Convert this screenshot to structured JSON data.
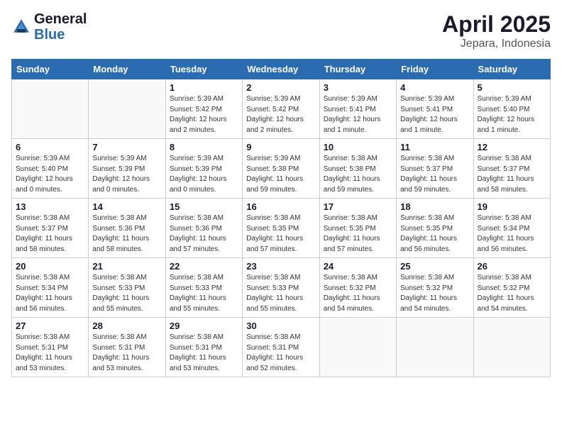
{
  "logo": {
    "line1": "General",
    "line2": "Blue"
  },
  "title": "April 2025",
  "subtitle": "Jepara, Indonesia",
  "weekdays": [
    "Sunday",
    "Monday",
    "Tuesday",
    "Wednesday",
    "Thursday",
    "Friday",
    "Saturday"
  ],
  "weeks": [
    [
      {
        "day": "",
        "info": ""
      },
      {
        "day": "",
        "info": ""
      },
      {
        "day": "1",
        "info": "Sunrise: 5:39 AM\nSunset: 5:42 PM\nDaylight: 12 hours\nand 2 minutes."
      },
      {
        "day": "2",
        "info": "Sunrise: 5:39 AM\nSunset: 5:42 PM\nDaylight: 12 hours\nand 2 minutes."
      },
      {
        "day": "3",
        "info": "Sunrise: 5:39 AM\nSunset: 5:41 PM\nDaylight: 12 hours\nand 1 minute."
      },
      {
        "day": "4",
        "info": "Sunrise: 5:39 AM\nSunset: 5:41 PM\nDaylight: 12 hours\nand 1 minute."
      },
      {
        "day": "5",
        "info": "Sunrise: 5:39 AM\nSunset: 5:40 PM\nDaylight: 12 hours\nand 1 minute."
      }
    ],
    [
      {
        "day": "6",
        "info": "Sunrise: 5:39 AM\nSunset: 5:40 PM\nDaylight: 12 hours\nand 0 minutes."
      },
      {
        "day": "7",
        "info": "Sunrise: 5:39 AM\nSunset: 5:39 PM\nDaylight: 12 hours\nand 0 minutes."
      },
      {
        "day": "8",
        "info": "Sunrise: 5:39 AM\nSunset: 5:39 PM\nDaylight: 12 hours\nand 0 minutes."
      },
      {
        "day": "9",
        "info": "Sunrise: 5:39 AM\nSunset: 5:38 PM\nDaylight: 11 hours\nand 59 minutes."
      },
      {
        "day": "10",
        "info": "Sunrise: 5:38 AM\nSunset: 5:38 PM\nDaylight: 11 hours\nand 59 minutes."
      },
      {
        "day": "11",
        "info": "Sunrise: 5:38 AM\nSunset: 5:37 PM\nDaylight: 11 hours\nand 59 minutes."
      },
      {
        "day": "12",
        "info": "Sunrise: 5:38 AM\nSunset: 5:37 PM\nDaylight: 11 hours\nand 58 minutes."
      }
    ],
    [
      {
        "day": "13",
        "info": "Sunrise: 5:38 AM\nSunset: 5:37 PM\nDaylight: 11 hours\nand 58 minutes."
      },
      {
        "day": "14",
        "info": "Sunrise: 5:38 AM\nSunset: 5:36 PM\nDaylight: 11 hours\nand 58 minutes."
      },
      {
        "day": "15",
        "info": "Sunrise: 5:38 AM\nSunset: 5:36 PM\nDaylight: 11 hours\nand 57 minutes."
      },
      {
        "day": "16",
        "info": "Sunrise: 5:38 AM\nSunset: 5:35 PM\nDaylight: 11 hours\nand 57 minutes."
      },
      {
        "day": "17",
        "info": "Sunrise: 5:38 AM\nSunset: 5:35 PM\nDaylight: 11 hours\nand 57 minutes."
      },
      {
        "day": "18",
        "info": "Sunrise: 5:38 AM\nSunset: 5:35 PM\nDaylight: 11 hours\nand 56 minutes."
      },
      {
        "day": "19",
        "info": "Sunrise: 5:38 AM\nSunset: 5:34 PM\nDaylight: 11 hours\nand 56 minutes."
      }
    ],
    [
      {
        "day": "20",
        "info": "Sunrise: 5:38 AM\nSunset: 5:34 PM\nDaylight: 11 hours\nand 56 minutes."
      },
      {
        "day": "21",
        "info": "Sunrise: 5:38 AM\nSunset: 5:33 PM\nDaylight: 11 hours\nand 55 minutes."
      },
      {
        "day": "22",
        "info": "Sunrise: 5:38 AM\nSunset: 5:33 PM\nDaylight: 11 hours\nand 55 minutes."
      },
      {
        "day": "23",
        "info": "Sunrise: 5:38 AM\nSunset: 5:33 PM\nDaylight: 11 hours\nand 55 minutes."
      },
      {
        "day": "24",
        "info": "Sunrise: 5:38 AM\nSunset: 5:32 PM\nDaylight: 11 hours\nand 54 minutes."
      },
      {
        "day": "25",
        "info": "Sunrise: 5:38 AM\nSunset: 5:32 PM\nDaylight: 11 hours\nand 54 minutes."
      },
      {
        "day": "26",
        "info": "Sunrise: 5:38 AM\nSunset: 5:32 PM\nDaylight: 11 hours\nand 54 minutes."
      }
    ],
    [
      {
        "day": "27",
        "info": "Sunrise: 5:38 AM\nSunset: 5:31 PM\nDaylight: 11 hours\nand 53 minutes."
      },
      {
        "day": "28",
        "info": "Sunrise: 5:38 AM\nSunset: 5:31 PM\nDaylight: 11 hours\nand 53 minutes."
      },
      {
        "day": "29",
        "info": "Sunrise: 5:38 AM\nSunset: 5:31 PM\nDaylight: 11 hours\nand 53 minutes."
      },
      {
        "day": "30",
        "info": "Sunrise: 5:38 AM\nSunset: 5:31 PM\nDaylight: 11 hours\nand 52 minutes."
      },
      {
        "day": "",
        "info": ""
      },
      {
        "day": "",
        "info": ""
      },
      {
        "day": "",
        "info": ""
      }
    ]
  ]
}
